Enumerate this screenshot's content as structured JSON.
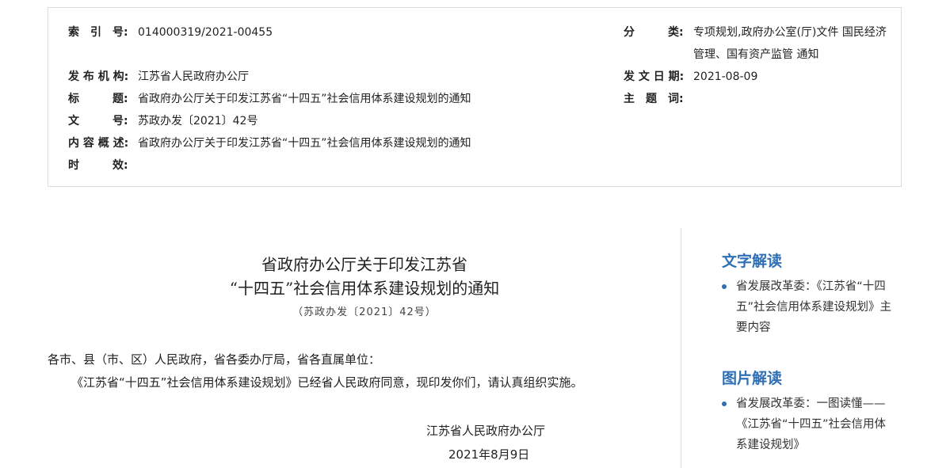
{
  "meta": {
    "index_label": "索　引　号:",
    "index_value": "014000319/2021-00455",
    "category_label": "分　　　类:",
    "category_value": "专项规划,政府办公室(厅)文件 国民经济管理、国有资产监管 通知",
    "publisher_label": "发 布 机 构:",
    "publisher_value": "江苏省人民政府办公厅",
    "date_label": "发 文 日 期:",
    "date_value": "2021-08-09",
    "title_label": "标　　　题:",
    "title_value": "省政府办公厅关于印发江苏省“十四五”社会信用体系建设规划的通知",
    "subject_label": "主　题　词:",
    "subject_value": "",
    "docno_label": "文　　　号:",
    "docno_value": "苏政办发〔2021〕42号",
    "summary_label": "内 容 概 述:",
    "summary_value": "省政府办公厅关于印发江苏省“十四五”社会信用体系建设规划的通知",
    "validity_label": "时　　　效:",
    "validity_value": ""
  },
  "document": {
    "title_line1": "省政府办公厅关于印发江苏省",
    "title_line2": "“十四五”社会信用体系建设规划的通知",
    "doc_number": "（苏政办发〔2021〕42号）",
    "salutation": "各市、县（市、区）人民政府，省各委办厅局，省各直属单位：",
    "paragraph": "《江苏省“十四五”社会信用体系建设规划》已经省人民政府同意，现印发你们，请认真组织实施。",
    "signature": "江苏省人民政府办公厅",
    "date": "2021年8月9日"
  },
  "sidebar": {
    "text_interpretation_title": "文字解读",
    "text_interpretation_items": [
      "省发展改革委：《江苏省“十四五”社会信用体系建设规划》主要内容"
    ],
    "image_interpretation_title": "图片解读",
    "image_interpretation_items": [
      "省发展改革委：一图读懂——《江苏省“十四五”社会信用体系建设规划》"
    ]
  },
  "colors": {
    "accent": "#2f6fb3",
    "border": "#dcdcdc"
  }
}
